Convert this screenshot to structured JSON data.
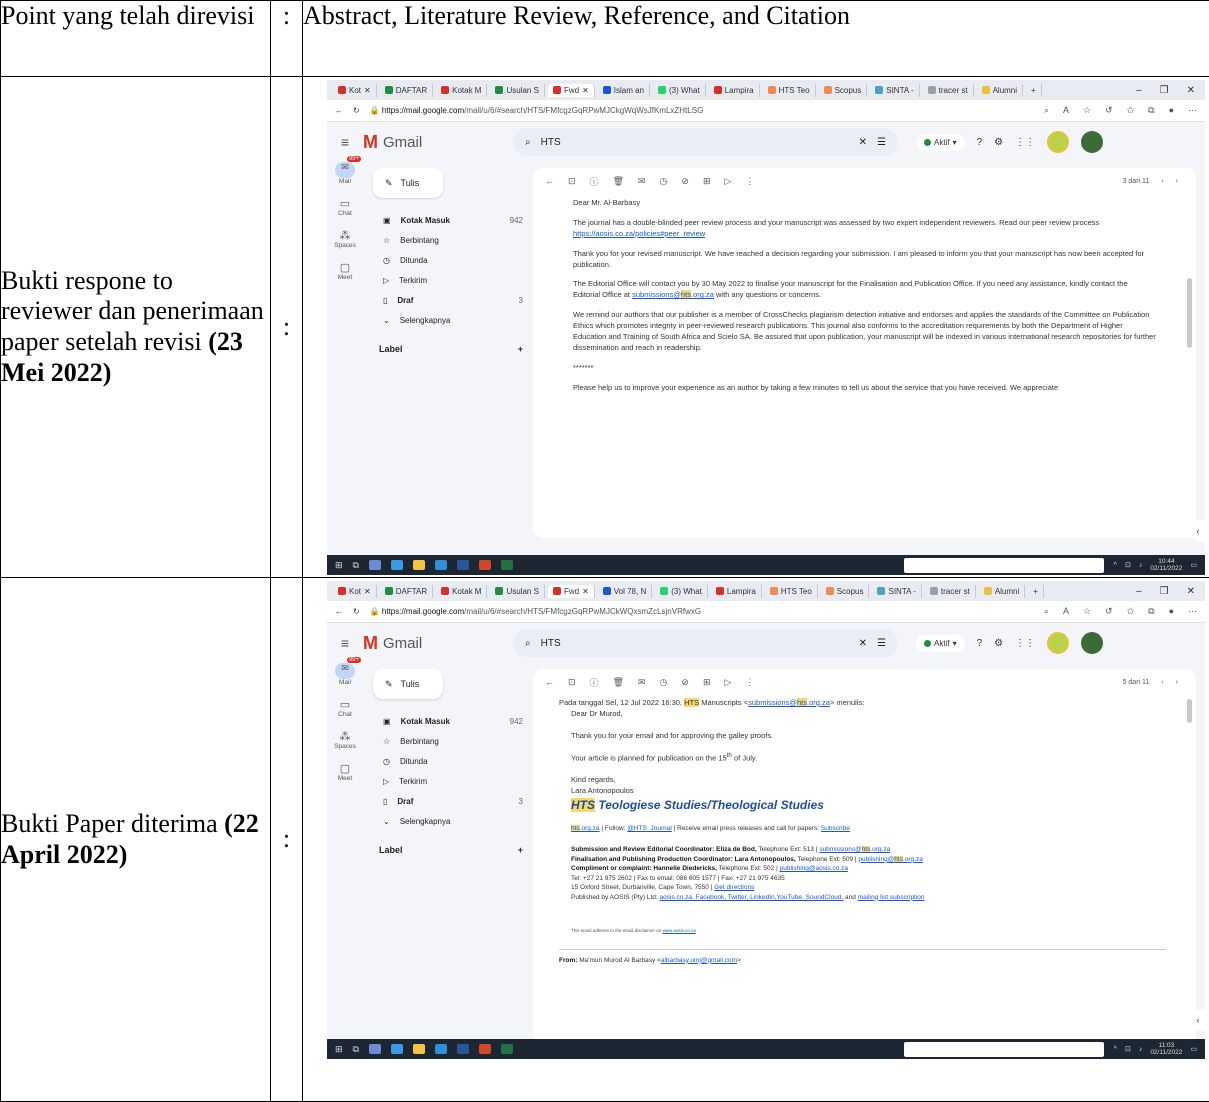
{
  "table": {
    "row1": {
      "label": "Point yang telah direvisi",
      "colon": ":",
      "value": "Abstract, Literature Review, Reference, and Citation"
    },
    "row2": {
      "label": "Bukti respone to reviewer dan penerimaan paper setelah revisi",
      "label_bold": "(23 Mei 2022)",
      "colon": ":"
    },
    "row3": {
      "label": "Bukti Paper diterima",
      "label_bold": "(22 April 2022)",
      "colon": ":"
    }
  },
  "colors": {
    "gmail_red": "#d93025",
    "link_blue": "#1a56db",
    "highlight": "#f7d86b",
    "brand_blue": "#1f4e9c",
    "online_green": "#1e8e3e"
  },
  "shot1": {
    "tabs": [
      "Kot",
      "DAFTAR",
      "Kotak M",
      "Usulan S",
      "Fwd",
      "Islam an",
      "(3) What",
      "Lampira",
      "HTS Teo",
      "Scopus",
      "SINTA -",
      "tracer st",
      "Alumni"
    ],
    "url_host": "https://mail.google.com",
    "url_path": "/mail/u/6/#search/HTS/FMfcgzGqRPwMJCkgWqWsJfKmLxZHtLSG",
    "gmail_label": "Gmail",
    "search_query": "HTS",
    "status_label": "Aktif",
    "compose_label": "Tulis",
    "rail": {
      "mail": "Mail",
      "chat": "Chat",
      "spaces": "Spaces",
      "meet": "Meet",
      "badge": "99+"
    },
    "nav": {
      "inbox": "Kotak Masuk",
      "inbox_count": "942",
      "starred": "Berbintang",
      "snoozed": "Ditunda",
      "sent": "Terkirim",
      "drafts": "Draf",
      "drafts_count": "3",
      "more": "Selengkapnya",
      "labels": "Label"
    },
    "pager": "3 dari 11",
    "email": {
      "greeting": "Dear Mr. Al-Barbasy",
      "p1": "The journal has a double-blinded peer review process and your manuscript was assessed by two expert independent reviewers. Read our peer review process",
      "p1_link": "https://aosis.co.za/policies#peer_review",
      "p2": "Thank you for your revised manuscript. We have reached a decision regarding your submission. I am pleased to inform you that your manuscript has now been accepted for publication.",
      "p3": "The Editorial Office will contact you by 30 May 2022 to finalise your manuscript for the Finalisation and Publication Office. If you need any assistance, kindly contact the Editorial Office at",
      "p3_link_a": "submissions@",
      "p3_link_hl": "hts",
      "p3_link_b": ".org.za",
      "p3_end": "with any questions or concerns.",
      "p4": "We remind our authors that our publisher is a member of CrossChecks plagiarism detection initiative and endorses and applies the standards of the Committee on Publication Ethics which promotes integrity in peer-reviewed research publications. This journal also conforms to the accreditation requirements by both the Department of Higher Education and Training of South Africa and Scielo SA. Be assured that upon publication, your manuscript will be indexed in various international research repositories for further dissemination and reach in readership.",
      "sep": "*******",
      "p5": "Please help us to improve your experience as an author by taking a few minutes to tell us about the service that you have received. We appreciate"
    },
    "clock_time": "10:44",
    "clock_date": "02/11/2022"
  },
  "shot2": {
    "tabs": [
      "Kot",
      "DAFTAR",
      "Kotak M",
      "Usulan S",
      "Fwd",
      "Vol 78, N",
      "(3) What",
      "Lampira",
      "HTS Teo",
      "Scopus",
      "SINTA -",
      "tracer st",
      "Alumni"
    ],
    "url_host": "https://mail.google.com",
    "url_path": "/mail/u/6/#search/HTS/FMfcgzGqRPwMJCkWQxsmZcLsjnVRfwxG",
    "gmail_label": "Gmail",
    "search_query": "HTS",
    "status_label": "Aktif",
    "compose_label": "Tulis",
    "rail": {
      "mail": "Mail",
      "chat": "Chat",
      "spaces": "Spaces",
      "meet": "Meet",
      "badge": "99+"
    },
    "nav": {
      "inbox": "Kotak Masuk",
      "inbox_count": "942",
      "starred": "Berbintang",
      "snoozed": "Ditunda",
      "sent": "Terkirim",
      "drafts": "Draf",
      "drafts_count": "3",
      "more": "Selengkapnya",
      "labels": "Label"
    },
    "pager": "5 dari 11",
    "email": {
      "quote_intro_a": "Pada tanggal Sel, 12 Jul 2022 16:30,",
      "quote_intro_hl": "HTS",
      "quote_intro_b": "Manuscripts <",
      "quote_email_a": "submissions@",
      "quote_email_hl": "hts",
      "quote_email_b": ".org.za",
      "quote_intro_end": "> menulis:",
      "greeting": "Dear Dr Murod,",
      "p1": "Thank you for your email and for approving the galley proofs.",
      "p2_a": "Your article is planned for publication on the 15",
      "p2_sup": "th",
      "p2_b": "of July.",
      "regards": "Kind regards,",
      "name": "Lara Antonopoulos",
      "hts_brand": "HTS",
      "journal": "Teologiese Studies/Theological Studies",
      "follow_link_hl": "hts",
      "follow_link": ".org.za",
      "follow_text": "| Follow:",
      "twitter": "@HTS_Journal",
      "follow_rest": "| Receive email press releases and call for papers:",
      "subscribe": "Subscribe",
      "s1_bold": "Submission and Review Editorial Coordinator: Eliza de Bod,",
      "s1_rest": "Telephone Ext: 513 |",
      "s1_link_a": "submissions@",
      "s1_link_hl": "hts",
      "s1_link_b": ".org.za",
      "s2_bold": "Finalisation and Publishing Production Coordinator: Lara Antonopoulos,",
      "s2_rest": "Telephone Ext: 509 |",
      "s2_link_a": "publishing@",
      "s2_link_hl": "hts",
      "s2_link_b": ".org.za",
      "s3_bold": "Compliment or complaint: Hannelie Diedericks,",
      "s3_rest": "Telephone Ext: 502 |",
      "s3_link": "publishing@aosis.co.za",
      "s4": "Tel: +27 21 975 2602 | Fax to email: 086 605 1577 | Fax: +27 21 975 4635",
      "s5": "15 Oxford Street, Durbanville, Cape Town, 7550 |",
      "s5_link": "Get directions",
      "s6": "Published by AOSIS (Pty) Ltd:",
      "s6_links": "aosis.co.za, Facebook, Twitter, LinkedIn,YouTube, SoundCloud,",
      "s6_and": "and",
      "s6_last": "mailing list subscription",
      "disclaimer": "This email adheres to the email disclaimer on",
      "disclaimer_link": "www.aosis.co.za",
      "from_label": "From:",
      "from_value": "Ma'mun Murod Al Barbasy <",
      "from_email": "albarbasy.umj@gmail.com",
      "from_end": ">"
    },
    "clock_time": "11:03",
    "clock_date": "02/11/2022"
  }
}
